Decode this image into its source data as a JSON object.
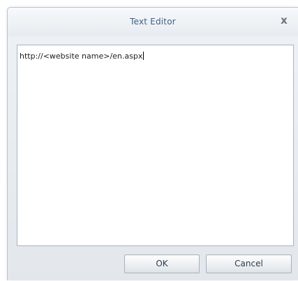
{
  "dialog": {
    "title": "Text Editor",
    "close_glyph": "x",
    "close_icon": "close-icon"
  },
  "editor": {
    "value": "http://<website name>/en.aspx"
  },
  "buttons": {
    "ok_label": "OK",
    "cancel_label": "Cancel"
  }
}
